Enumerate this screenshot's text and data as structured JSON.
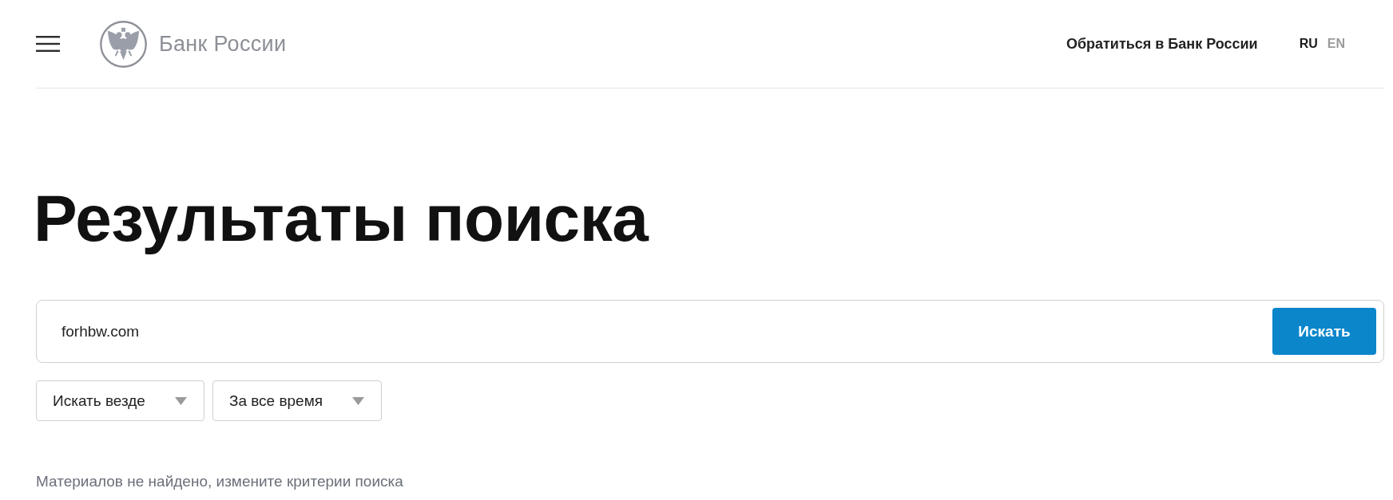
{
  "header": {
    "logo_text": "Банк России",
    "contact_link": "Обратиться в Банк России",
    "languages": [
      {
        "label": "RU",
        "selected": true
      },
      {
        "label": "EN",
        "selected": false
      }
    ]
  },
  "heading": "Результаты поиска",
  "search": {
    "value": "forhbw.com",
    "button": "Искать"
  },
  "filters": [
    {
      "label": "Искать везде"
    },
    {
      "label": "За все время"
    }
  ],
  "message": "Материалов не найдено, измените критерии поиска"
}
